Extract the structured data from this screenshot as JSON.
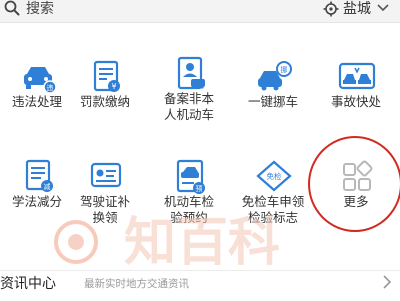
{
  "search": {
    "text": "搜索"
  },
  "location": {
    "city": "盐城"
  },
  "grid": {
    "items": [
      {
        "label": "违法处理",
        "icon": "car-violation-icon"
      },
      {
        "label": "罚款缴纳",
        "icon": "fine-payment-icon"
      },
      {
        "label": "备案非本人机动车",
        "icon": "vehicle-registration-icon"
      },
      {
        "label": "一键挪车",
        "icon": "move-car-icon"
      },
      {
        "label": "事故快处",
        "icon": "accident-icon"
      },
      {
        "label": "学法减分",
        "icon": "study-points-icon"
      },
      {
        "label": "驾驶证补换领",
        "icon": "license-replace-icon"
      },
      {
        "label": "机动车检验预约",
        "icon": "inspection-booking-icon"
      },
      {
        "label": "免检车申领检验标志",
        "icon": "exempt-label-icon"
      },
      {
        "label": "更多",
        "icon": "more-grid-icon"
      }
    ]
  },
  "news": {
    "title": "资讯中心",
    "subtitle": "最新实时地方交通资讯"
  },
  "colors": {
    "accent": "#2f7fd6",
    "badge": "#2f7fd6",
    "annotation": "#d12a1f",
    "watermark": "#f0a08a"
  }
}
